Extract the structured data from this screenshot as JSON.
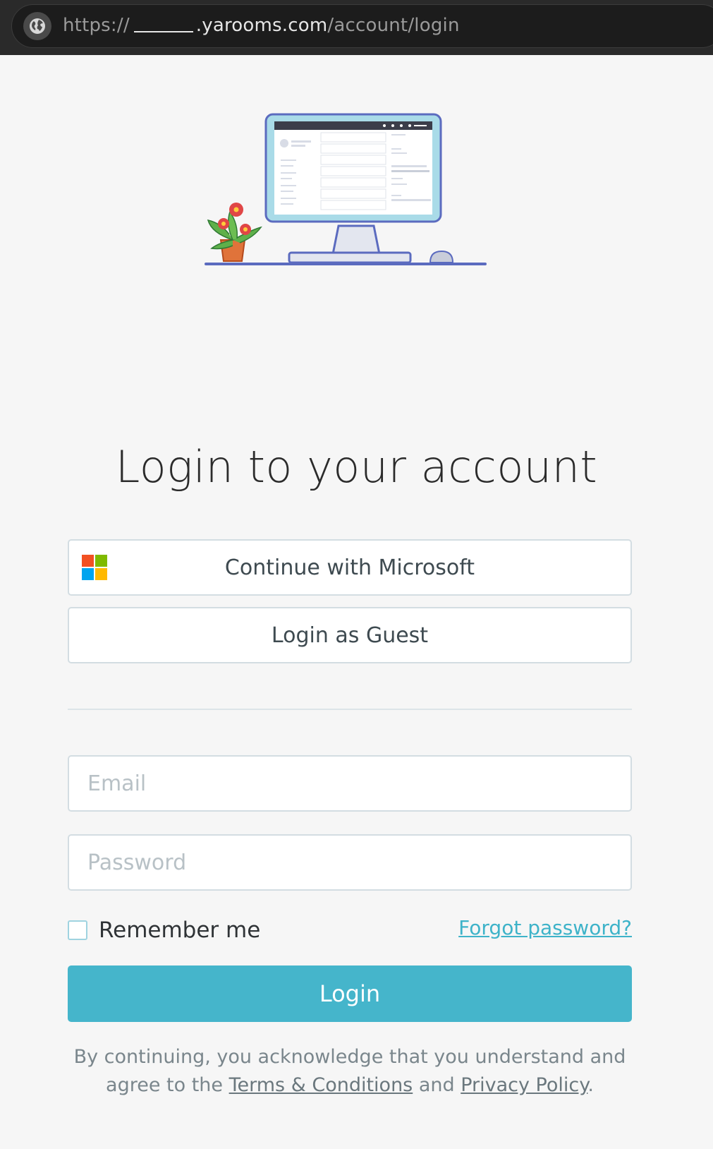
{
  "browser": {
    "url_scheme": "https://",
    "url_host": ".yarooms.com",
    "url_path": "/account/login",
    "icon": "globe-icon"
  },
  "login": {
    "title": "Login to your account",
    "microsoft_button": "Continue with Microsoft",
    "guest_button": "Login as Guest",
    "email_placeholder": "Email",
    "password_placeholder": "Password",
    "remember_label": "Remember me",
    "forgot_link": "Forgot password?",
    "login_button": "Login",
    "legal_prefix": "By continuing, you acknowledge that you understand and agree to the ",
    "terms_link": "Terms & Conditions",
    "legal_and": " and ",
    "privacy_link": "Privacy Policy",
    "legal_suffix": "."
  },
  "colors": {
    "accent": "#45b5cb",
    "link": "#3eb3c9",
    "microsoft_red": "#f25022",
    "microsoft_green": "#7fba00",
    "microsoft_blue": "#00a4ef",
    "microsoft_yellow": "#ffb900"
  }
}
